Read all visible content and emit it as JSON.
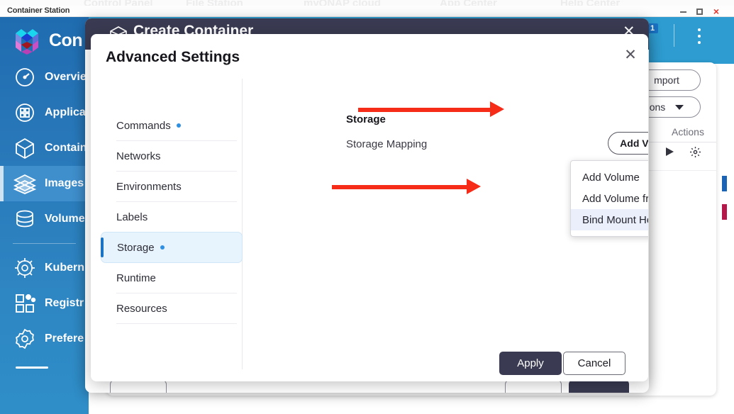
{
  "browser": {
    "ghost_tabs": [
      "Control Panel",
      "File Station",
      "myQNAP cloud",
      "App Center",
      "Help Center"
    ]
  },
  "window": {
    "title": "Container Station",
    "controls": {
      "minimize": "minimize-icon",
      "maximize": "maximize-icon",
      "close": "×"
    }
  },
  "sidebar": {
    "brand": "Con",
    "logo_icon": "container-station-logo",
    "items": [
      {
        "label": "Overvie",
        "icon": "gauge-icon",
        "active": false
      },
      {
        "label": "Applica",
        "icon": "grid-apps-icon",
        "active": false
      },
      {
        "label": "Contain",
        "icon": "cube-icon",
        "active": false
      },
      {
        "label": "Images",
        "icon": "layers-icon",
        "active": true
      },
      {
        "label": "Volume",
        "icon": "database-icon",
        "active": false
      },
      {
        "label": "Kubern",
        "icon": "helm-wheel-icon",
        "active": false
      },
      {
        "label": "Registr",
        "icon": "registry-squares-icon",
        "active": false
      },
      {
        "label": "Prefere",
        "icon": "gear-badge-icon",
        "active": false
      }
    ]
  },
  "background_page": {
    "notification_badge": "1",
    "kebab_icon": "more-vertical-icon",
    "import_button": "mport",
    "actions_dropdown": "ons",
    "table_header_actions": "Actions",
    "row_icons": [
      "play-icon",
      "gear-icon"
    ]
  },
  "create_container_dialog": {
    "title": "Create Container",
    "icon": "cube-icon",
    "close": "✕"
  },
  "advanced_settings": {
    "title": "Advanced Settings",
    "close": "✕",
    "nav": [
      {
        "label": "Commands",
        "has_dot": true,
        "active": false
      },
      {
        "label": "Networks",
        "has_dot": false,
        "active": false
      },
      {
        "label": "Environments",
        "has_dot": false,
        "active": false
      },
      {
        "label": "Labels",
        "has_dot": false,
        "active": false
      },
      {
        "label": "Storage",
        "has_dot": true,
        "active": true
      },
      {
        "label": "Runtime",
        "has_dot": false,
        "active": false
      },
      {
        "label": "Resources",
        "has_dot": false,
        "active": false
      }
    ],
    "storage": {
      "heading": "Storage",
      "mapping_label": "Storage Mapping",
      "add_volume_button": "Add Volume",
      "caret_icon": "chevron-up-icon",
      "dropdown_items": [
        {
          "label": "Add Volume",
          "highlighted": false
        },
        {
          "label": "Add Volume from Contain…",
          "highlighted": false
        },
        {
          "label": "Bind Mount Host Path",
          "highlighted": true
        }
      ]
    },
    "footer": {
      "apply": "Apply",
      "cancel": "Cancel"
    }
  },
  "annotations": {
    "arrow_color": "#f62b18",
    "arrows": [
      {
        "name": "arrow-to-add-volume"
      },
      {
        "name": "arrow-to-bind-mount-host-path"
      }
    ]
  },
  "colors": {
    "sidebar_blue": "#2877b8",
    "topbar_blue": "#2e9cd0",
    "header_navy": "#3a3a52",
    "accent_blue": "#1a73c4",
    "highlight": "#eaeffb",
    "arrow_red": "#f62b18"
  }
}
